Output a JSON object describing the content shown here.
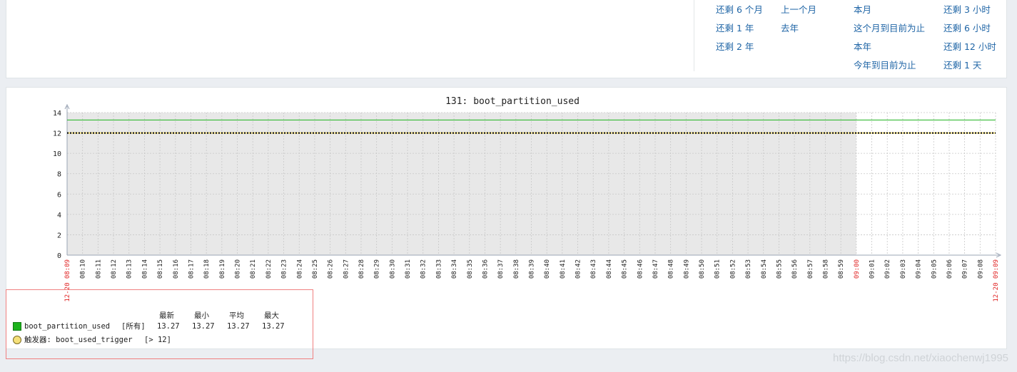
{
  "periods": {
    "col1": [
      "还剩 6 个月",
      "还剩 1 年",
      "还剩 2 年"
    ],
    "col2": [
      "上一个月",
      "去年"
    ],
    "col3": [
      "本月",
      "这个月到目前为止",
      "本年",
      "今年到目前为止"
    ],
    "col4": [
      "还剩 3 小时",
      "还剩 6 小时",
      "还剩 12 小时",
      "还剩 1 天"
    ]
  },
  "colors": {
    "link": "#1f65a6",
    "series": "#1db31d",
    "trigger": "#f5e07a",
    "axis_red": "#e02020",
    "plot_bg": "#e8e8e8"
  },
  "chart_data": {
    "type": "line",
    "title": "131: boot_partition_used",
    "ylim": [
      0,
      14
    ],
    "yticks": [
      "0",
      "2",
      "4",
      "6",
      "8",
      "10",
      "12",
      "14"
    ],
    "x_start_label": "12-20 08:09",
    "x_end_label": "12-20 09:09",
    "x_hour_label": "09:00",
    "x_ticks": [
      "08:10",
      "08:11",
      "08:12",
      "08:13",
      "08:14",
      "08:15",
      "08:16",
      "08:17",
      "08:18",
      "08:19",
      "08:20",
      "08:21",
      "08:22",
      "08:23",
      "08:24",
      "08:25",
      "08:26",
      "08:27",
      "08:28",
      "08:29",
      "08:30",
      "08:31",
      "08:32",
      "08:33",
      "08:34",
      "08:35",
      "08:36",
      "08:37",
      "08:38",
      "08:39",
      "08:40",
      "08:41",
      "08:42",
      "08:43",
      "08:44",
      "08:45",
      "08:46",
      "08:47",
      "08:48",
      "08:49",
      "08:50",
      "08:51",
      "08:52",
      "08:53",
      "08:54",
      "08:55",
      "08:56",
      "08:57",
      "08:58",
      "08:59",
      "09:00",
      "09:01",
      "09:02",
      "09:03",
      "09:04",
      "09:05",
      "09:06",
      "09:07",
      "09:08"
    ],
    "data_end": "09:00",
    "series": [
      {
        "name": "boot_partition_used",
        "value": 13.27
      }
    ],
    "trigger": {
      "name": "boot_used_trigger",
      "threshold": 12
    },
    "grid": true
  },
  "legend": {
    "headers": [
      "最新",
      "最小",
      "平均",
      "最大"
    ],
    "series_name": "boot_partition_used",
    "series_scope": "[所有]",
    "series_values": [
      "13.27",
      "13.27",
      "13.27",
      "13.27"
    ],
    "trigger_label": "触发器: boot_used_trigger",
    "trigger_condition": "[> 12]"
  },
  "watermark": "https://blog.csdn.net/xiaochenwj1995"
}
